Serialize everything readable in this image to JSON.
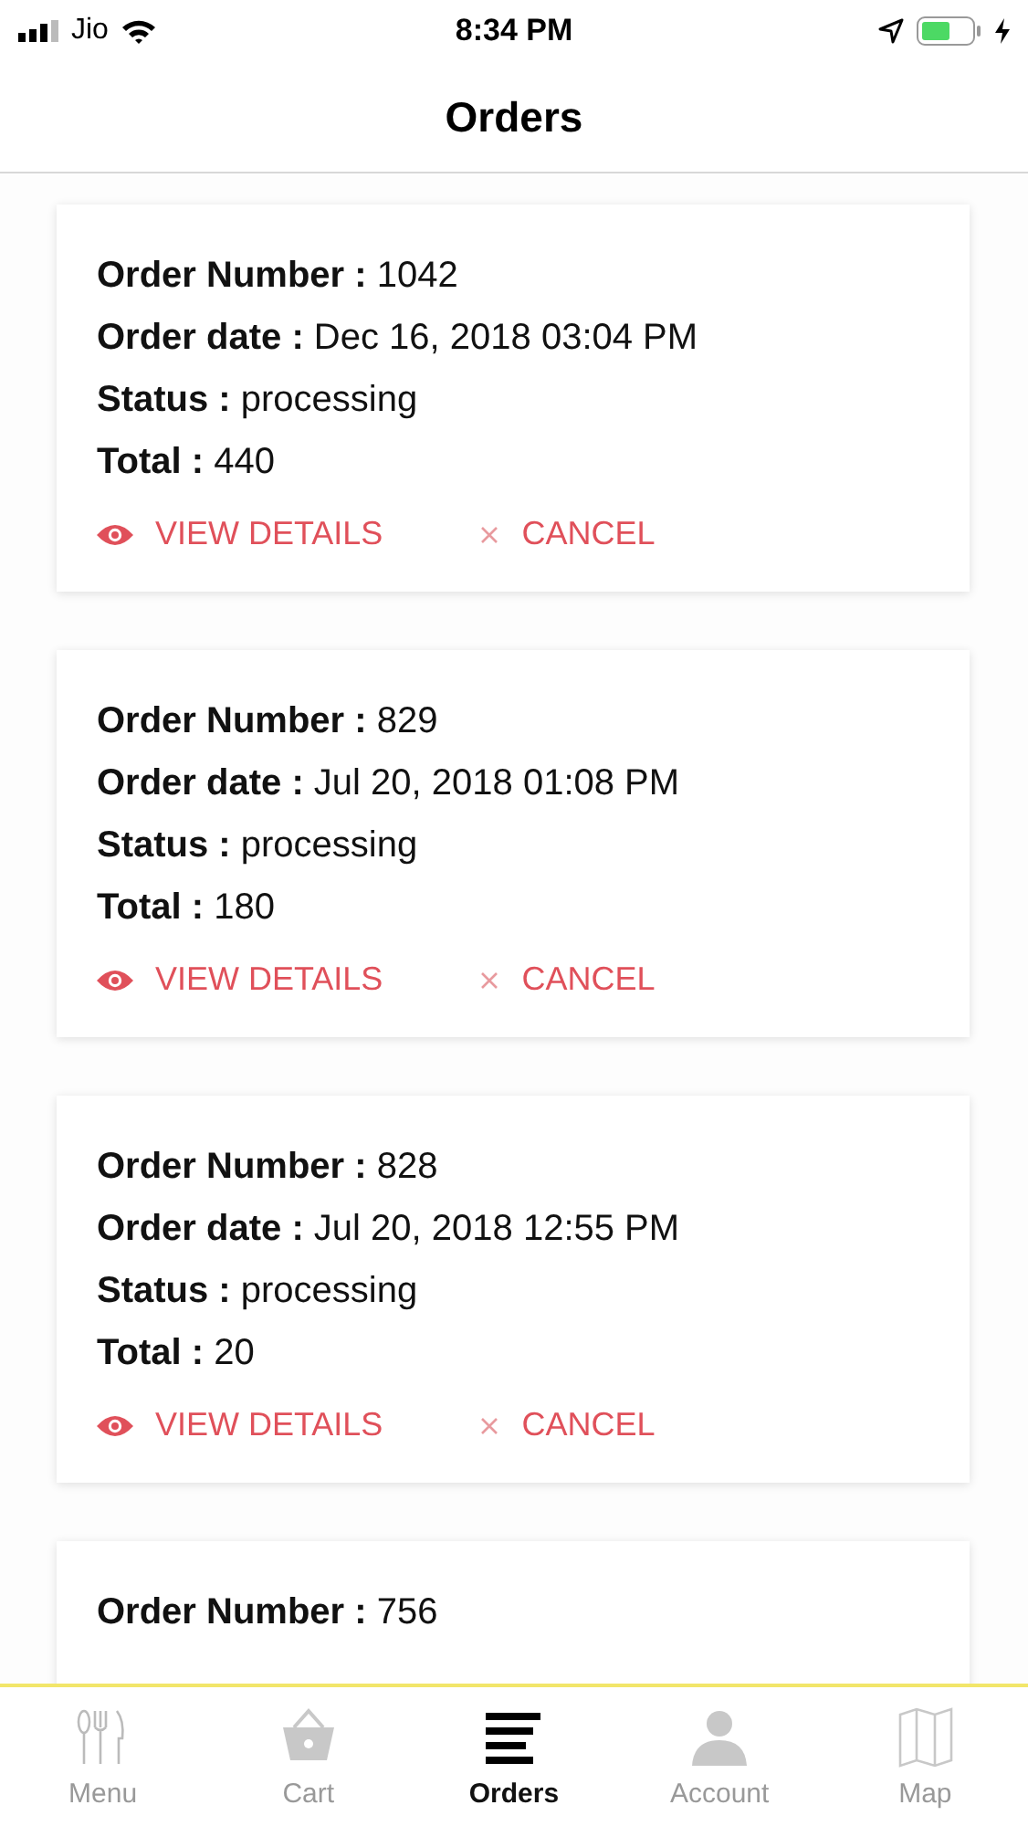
{
  "status_bar": {
    "carrier": "Jio",
    "time": "8:34 PM"
  },
  "header": {
    "title": "Orders"
  },
  "orders": [
    {
      "fields": [
        {
          "label": "Order Number :",
          "value": "1042"
        },
        {
          "label": "Order date :",
          "value": "Dec 16, 2018 03:04 PM"
        },
        {
          "label": "Status :",
          "value": "processing"
        },
        {
          "label": "Total :",
          "value": "440"
        }
      ],
      "actions": [
        "VIEW DETAILS",
        "CANCEL"
      ]
    },
    {
      "fields": [
        {
          "label": "Order Number :",
          "value": "829"
        },
        {
          "label": "Order date :",
          "value": "Jul 20, 2018 01:08 PM"
        },
        {
          "label": "Status :",
          "value": "processing"
        },
        {
          "label": "Total :",
          "value": "180"
        }
      ],
      "actions": [
        "VIEW DETAILS",
        "CANCEL"
      ]
    },
    {
      "fields": [
        {
          "label": "Order Number :",
          "value": "828"
        },
        {
          "label": "Order date :",
          "value": "Jul 20, 2018 12:55 PM"
        },
        {
          "label": "Status :",
          "value": "processing"
        },
        {
          "label": "Total :",
          "value": "20"
        }
      ],
      "actions": [
        "VIEW DETAILS",
        "CANCEL"
      ]
    },
    {
      "fields": [
        {
          "label": "Order Number :",
          "value": "756"
        }
      ]
    }
  ],
  "tab_bar": [
    {
      "label": "Menu",
      "selected": false
    },
    {
      "label": "Cart",
      "selected": false
    },
    {
      "label": "Orders",
      "selected": true
    },
    {
      "label": "Account",
      "selected": false
    },
    {
      "label": "Map",
      "selected": false
    }
  ]
}
